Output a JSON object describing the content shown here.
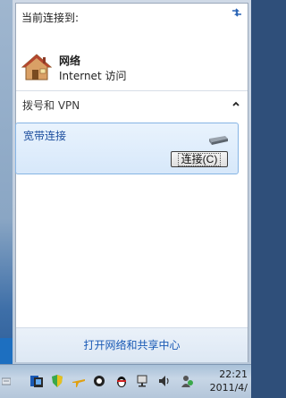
{
  "flyout": {
    "current_title": "当前连接到:",
    "network": {
      "name": "网络",
      "access": "Internet 访问"
    },
    "dialup_section": {
      "title": "拨号和 VPN",
      "connection": {
        "name": "宽带连接",
        "connect_label": "连接(C)"
      }
    },
    "footer_link": "打开网络和共享中心"
  },
  "taskbar": {
    "tray_icons": [
      "keyboard-icon",
      "network-status-icon",
      "shield-icon",
      "airplane-icon",
      "qq-penguin-icon",
      "qq-icon",
      "network-tray-icon",
      "volume-icon",
      "user-icon"
    ],
    "clock": {
      "time": "22:21",
      "date": "2011/4/"
    }
  },
  "colors": {
    "link": "#1a5ab5",
    "selected_bg": "#d7e8fa",
    "selected_border": "#86b4e4"
  }
}
